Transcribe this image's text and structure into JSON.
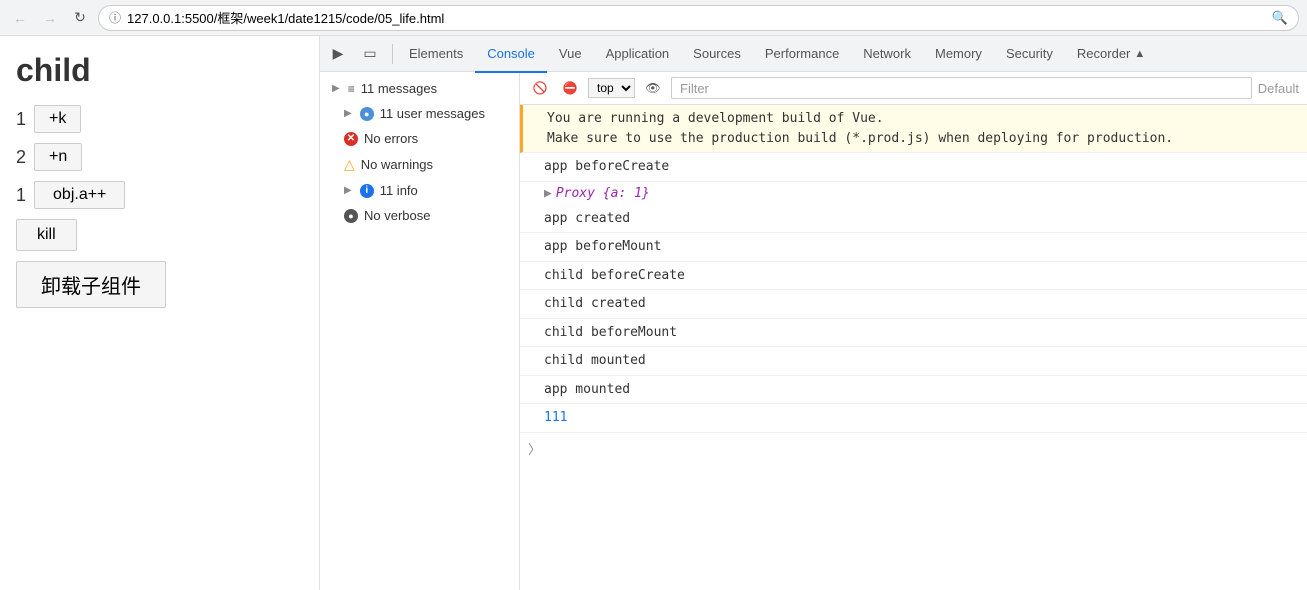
{
  "browser": {
    "url": "127.0.0.1:5500/框架/week1/date1215/code/05_life.html",
    "back_disabled": true,
    "forward_disabled": true
  },
  "page": {
    "title": "child",
    "row1_num": "1",
    "row1_btn": "+k",
    "row2_num": "2",
    "row2_btn": "+n",
    "row3_num": "1",
    "row3_btn": "obj.a++",
    "kill_btn": "kill",
    "unmount_btn": "卸载子组件"
  },
  "devtools": {
    "tabs": [
      {
        "label": "Elements",
        "active": false
      },
      {
        "label": "Console",
        "active": true
      },
      {
        "label": "Vue",
        "active": false
      },
      {
        "label": "Application",
        "active": false
      },
      {
        "label": "Sources",
        "active": false
      },
      {
        "label": "Performance",
        "active": false
      },
      {
        "label": "Network",
        "active": false
      },
      {
        "label": "Memory",
        "active": false
      },
      {
        "label": "Security",
        "active": false
      },
      {
        "label": "Recorder",
        "active": false
      }
    ],
    "sidebar": {
      "items": [
        {
          "label": "11 messages",
          "icon": "list",
          "has_arrow": true
        },
        {
          "label": "11 user messages",
          "icon": "user",
          "has_arrow": true
        },
        {
          "label": "No errors",
          "icon": "error",
          "has_arrow": false
        },
        {
          "label": "No warnings",
          "icon": "warning",
          "has_arrow": false
        },
        {
          "label": "11 info",
          "icon": "info",
          "has_arrow": true
        },
        {
          "label": "No verbose",
          "icon": "verbose",
          "has_arrow": false
        }
      ]
    },
    "filter": {
      "placeholder": "Filter",
      "default_label": "Default"
    },
    "top_selector": "top",
    "messages": [
      {
        "text": "You are running a development build of Vue.\nMake sure to use the production build (*.prod.js) when deploying for production.",
        "type": "warning"
      },
      {
        "text": "app beforeCreate",
        "type": "normal"
      },
      {
        "text": "▶ Proxy {a: 1}",
        "type": "proxy"
      },
      {
        "text": "app created",
        "type": "normal"
      },
      {
        "text": "app beforeMount",
        "type": "normal"
      },
      {
        "text": "child beforeCreate",
        "type": "normal"
      },
      {
        "text": "child created",
        "type": "normal"
      },
      {
        "text": "child beforeMount",
        "type": "normal"
      },
      {
        "text": "child mounted",
        "type": "normal"
      },
      {
        "text": "app mounted",
        "type": "normal"
      },
      {
        "text": "111",
        "type": "blue"
      }
    ]
  }
}
